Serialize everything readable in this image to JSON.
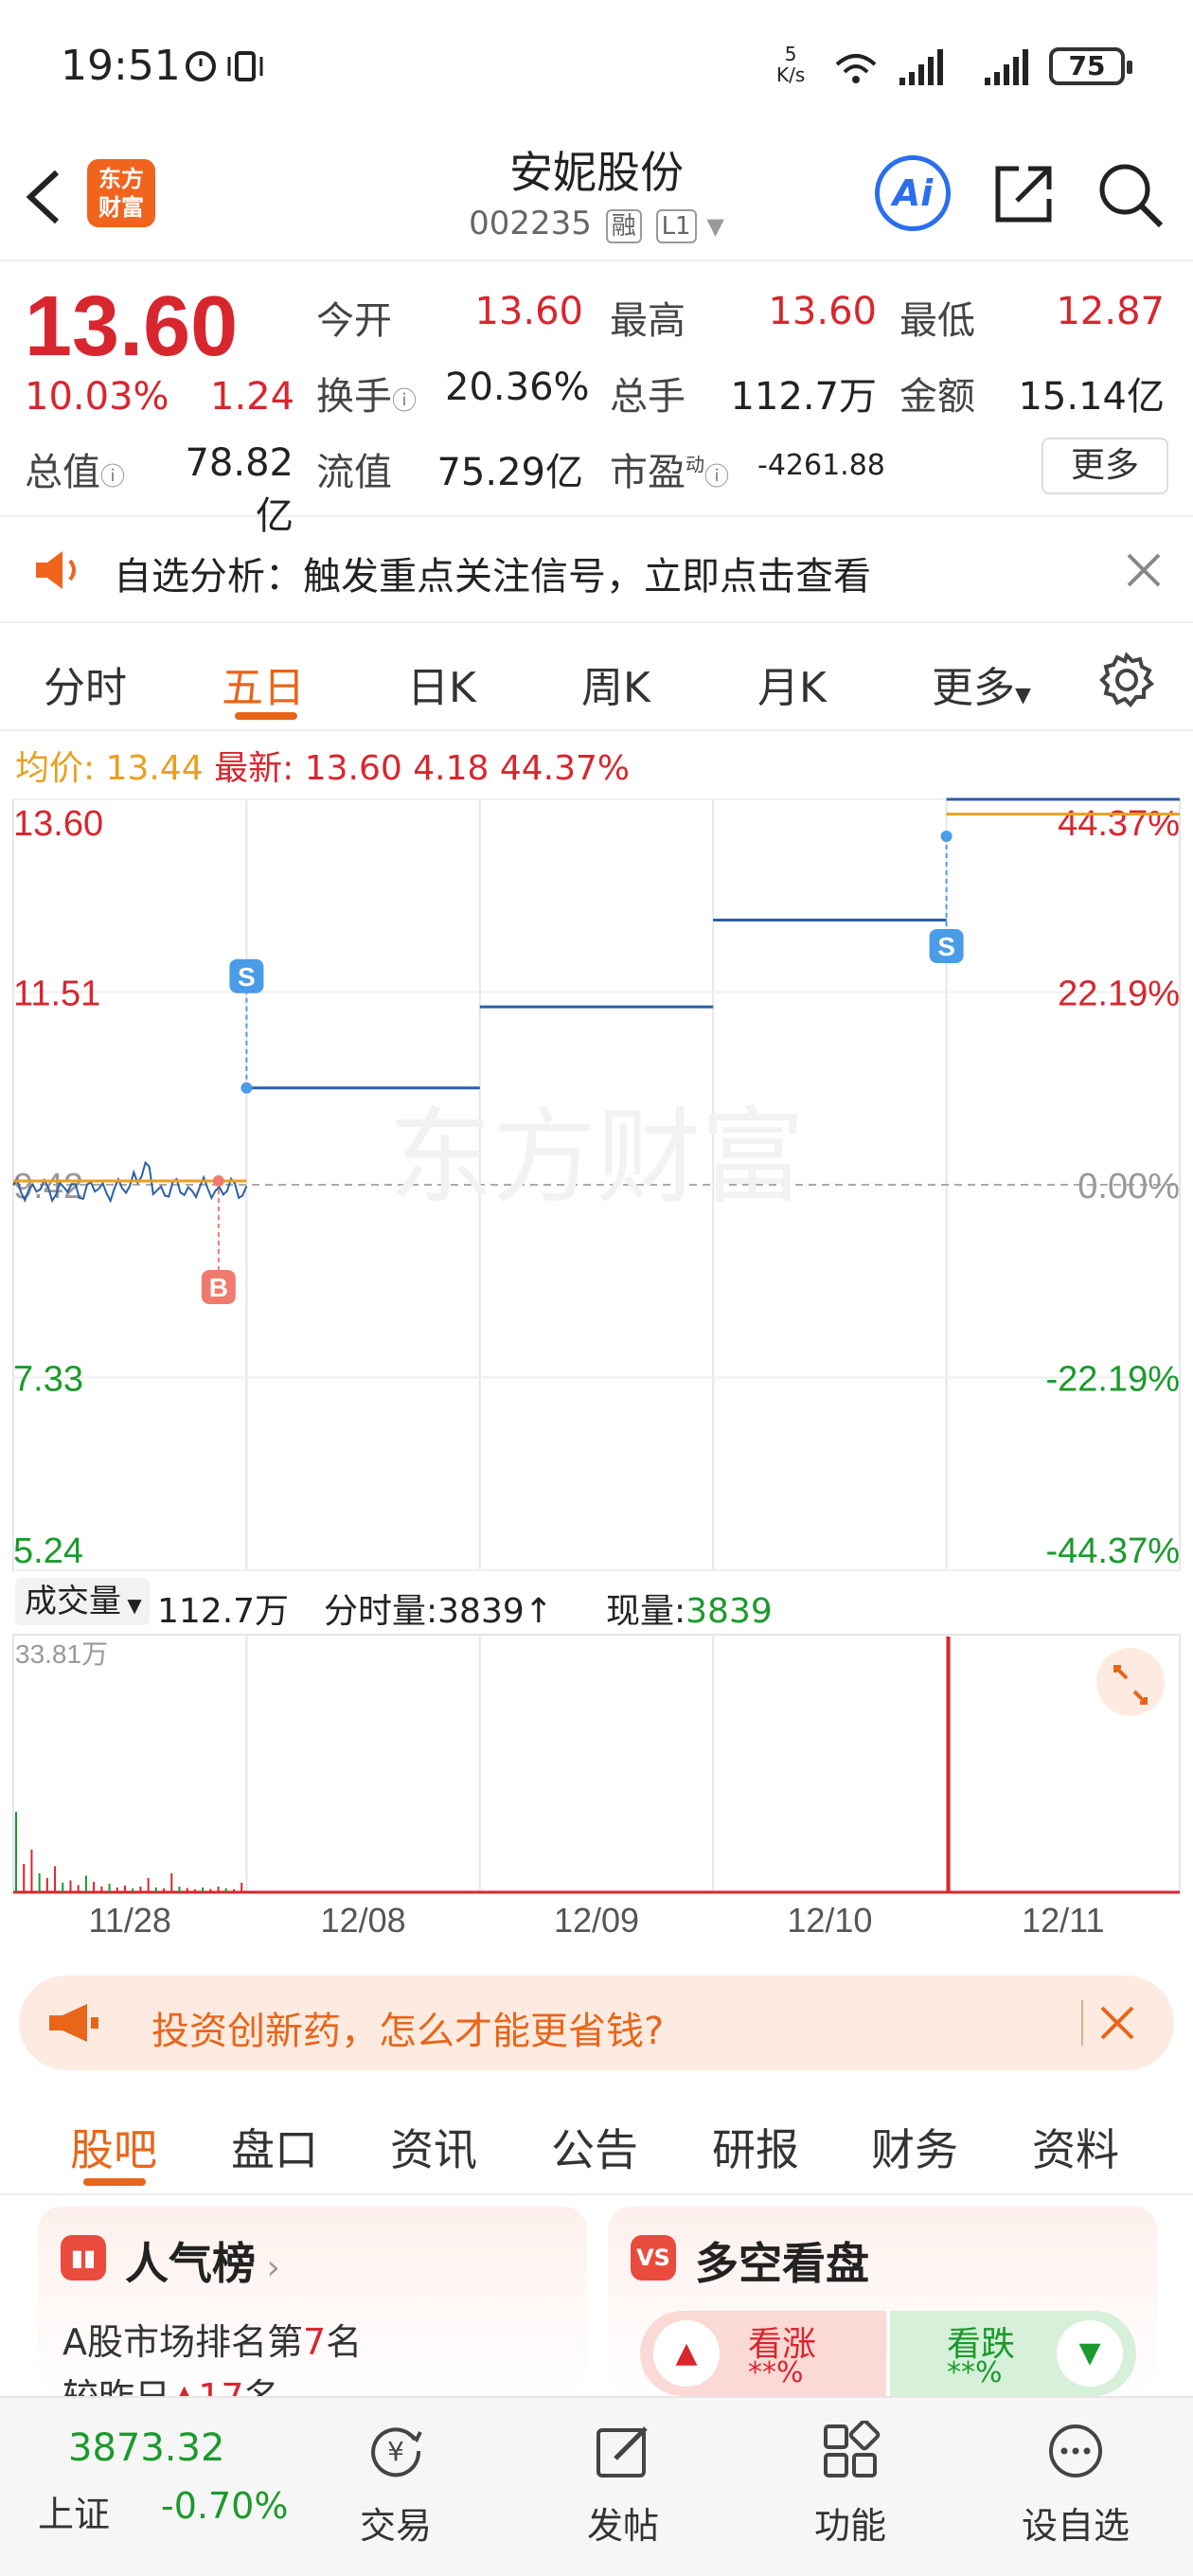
{
  "status_bar": {
    "time": "19:51",
    "net_speed_top": "5",
    "net_speed_bottom": "K/s",
    "battery": "75"
  },
  "header": {
    "logo_line1": "东方",
    "logo_line2": "财富",
    "stock_name": "安妮股份",
    "stock_code": "002235",
    "tag_margin": "融",
    "tag_level": "L1",
    "ai_label": "Ai"
  },
  "quote": {
    "price": "13.60",
    "change_pct": "10.03%",
    "change_amt": "1.24",
    "open_label": "今开",
    "open": "13.60",
    "high_label": "最高",
    "high": "13.60",
    "low_label": "最低",
    "low": "12.87",
    "turnover_label": "换手",
    "turnover": "20.36%",
    "volume_label": "总手",
    "volume": "112.7万",
    "amount_label": "金额",
    "amount": "15.14亿",
    "mktcap_label": "总值",
    "mktcap": "78.82亿",
    "float_label": "流值",
    "float": "75.29亿",
    "pe_label": "市盈",
    "pe_sup": "动",
    "pe": "-4261.88",
    "more_label": "更多"
  },
  "notice": {
    "text": "自选分析：触发重点关注信号，立即点击查看"
  },
  "chart_tabs": {
    "items": [
      "分时",
      "五日",
      "日K",
      "周K",
      "月K",
      "更多"
    ],
    "active": "五日"
  },
  "info_line": {
    "avg_label": "均价:",
    "avg": "13.44",
    "latest_label": "最新:",
    "latest": "13.60",
    "chg": "4.18",
    "pct": "44.37%"
  },
  "chart_data": {
    "type": "line",
    "title": "",
    "x": [
      "11/28",
      "12/08",
      "12/09",
      "12/10",
      "12/11"
    ],
    "y_left_ticks": [
      "13.60",
      "11.51",
      "9.42",
      "7.33",
      "5.24"
    ],
    "y_right_ticks": [
      "44.37%",
      "22.19%",
      "0.00%",
      "-22.19%",
      "-44.37%"
    ],
    "ylim": [
      5.24,
      13.6
    ],
    "series": [
      {
        "name": "价格",
        "values": [
          9.42,
          10.47,
          11.35,
          12.29,
          13.6
        ],
        "color": "#2b5fa8"
      },
      {
        "name": "均价",
        "values": [
          9.42,
          9.42,
          9.42,
          9.42,
          13.44
        ],
        "color": "#e8a020"
      }
    ],
    "markers": [
      {
        "label": "B",
        "day": "11/28"
      },
      {
        "label": "S",
        "day": "11/28"
      },
      {
        "label": "S",
        "day": "12/10"
      }
    ],
    "watermark": "东方财富",
    "volume_max_label": "33.81万"
  },
  "volume_line": {
    "selector": "成交量",
    "total": "112.7万",
    "tick_label": "分时量:",
    "tick_value": "3839",
    "now_label": "现量:",
    "now_value": "3839"
  },
  "ad": {
    "text": "投资创新药，怎么才能更省钱?"
  },
  "info_tabs": {
    "items": [
      "股吧",
      "盘口",
      "资讯",
      "公告",
      "研报",
      "财务",
      "资料"
    ],
    "active": "股吧"
  },
  "cards": {
    "popularity": {
      "title": "人气榜",
      "line1": "A股市场排名第",
      "rank": "7",
      "line1_suffix": "名",
      "line2": "较昨日",
      "delta": "17",
      "line2_suffix": "名"
    },
    "bullbear": {
      "title": "多空看盘",
      "up_label": "看涨",
      "up_value": "**%",
      "down_label": "看跌",
      "down_value": "**%"
    }
  },
  "bottom_nav": {
    "index_value": "3873.32",
    "index_name": "上证",
    "index_change": "-0.70%",
    "items": [
      "交易",
      "发帖",
      "功能",
      "设自选"
    ]
  }
}
